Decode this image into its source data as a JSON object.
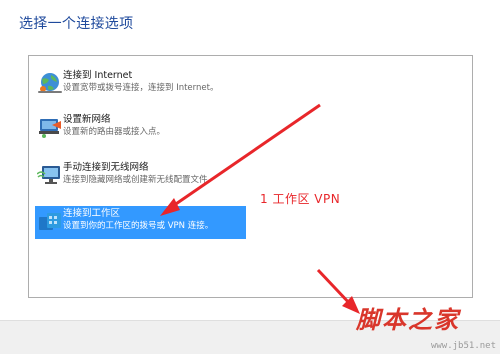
{
  "dialog": {
    "heading": "选择一个连接选项"
  },
  "options": [
    {
      "title": "连接到 Internet",
      "description": "设置宽带或拨号连接，连接到 Internet。",
      "icon": "globe-network-icon",
      "selected": false
    },
    {
      "title": "设置新网络",
      "description": "设置新的路由器或接入点。",
      "icon": "router-setup-icon",
      "selected": false
    },
    {
      "title": "手动连接到无线网络",
      "description": "连接到隐藏网络或创建新无线配置文件。",
      "icon": "wireless-monitor-icon",
      "selected": false
    },
    {
      "title": "连接到工作区",
      "description": "设置到你的工作区的拨号或 VPN 连接。",
      "icon": "workplace-briefcase-icon",
      "selected": true
    }
  ],
  "annotation": {
    "text": "1 工作区  VPN",
    "color": "#e8262a"
  },
  "watermark": {
    "logo": "脚本之家",
    "url": "www.jb51.net"
  },
  "colors": {
    "heading": "#1f4a9c",
    "selection": "#3399ff",
    "arrow": "#e8262a"
  }
}
